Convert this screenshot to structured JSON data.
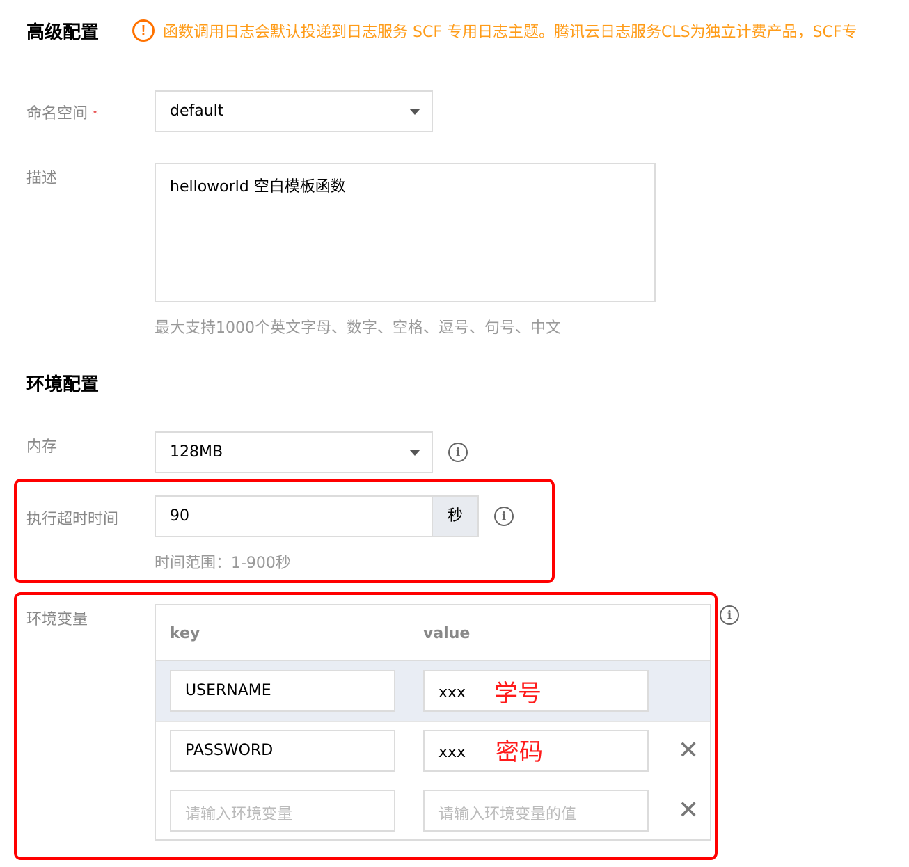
{
  "advanced": {
    "title": "高级配置",
    "notice": "函数调用日志会默认投递到日志服务 SCF 专用日志主题。腾讯云日志服务CLS为独立计费产品，SCF专"
  },
  "namespace": {
    "label": "命名空间",
    "required_mark": "*",
    "value": "default"
  },
  "description": {
    "label": "描述",
    "value": "helloworld 空白模板函数",
    "hint": "最大支持1000个英文字母、数字、空格、逗号、句号、中文"
  },
  "env_config": {
    "title": "环境配置"
  },
  "memory": {
    "label": "内存",
    "value": "128MB"
  },
  "timeout": {
    "label": "执行超时时间",
    "value": "90",
    "unit": "秒",
    "hint": "时间范围：1-900秒"
  },
  "env_vars": {
    "label": "环境变量",
    "columns": {
      "key": "key",
      "value": "value"
    },
    "rows": [
      {
        "key": "USERNAME",
        "value": "xxx",
        "annotation": "学号"
      },
      {
        "key": "PASSWORD",
        "value": "xxx",
        "annotation": "密码"
      }
    ],
    "new_row": {
      "key_placeholder": "请输入环境变量",
      "value_placeholder": "请输入环境变量的值"
    }
  },
  "icons": {
    "notice": "warning-circle-icon",
    "info": "info-circle-icon",
    "remove": "close-icon",
    "dropdown": "caret-down-icon"
  },
  "colors": {
    "warning": "#ff9c19",
    "highlight_border": "#ff0000",
    "annotation": "#ff1a1a",
    "row_highlight": "#e9edf4"
  }
}
